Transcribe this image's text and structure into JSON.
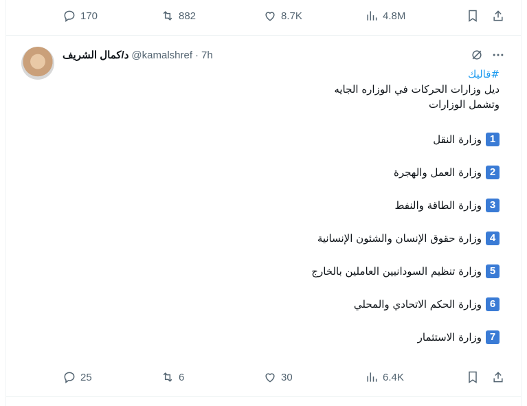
{
  "prev_tweet": {
    "actions": {
      "reply_count": "170",
      "retweet_count": "882",
      "like_count": "8.7K",
      "views_count": "4.8M"
    }
  },
  "tweet": {
    "display_name": "د/كمال الشريف",
    "handle": "@kamalshref",
    "dot": "·",
    "time": "7h",
    "hashtag": "#قاليك",
    "text_lines": [
      "ديل وزارات الحركات في الوزاره الجايه",
      "وتشمل الوزارات"
    ],
    "items": [
      {
        "num": "1",
        "label": "وزارة النقل"
      },
      {
        "num": "2",
        "label": "وزارة العمل والهجرة"
      },
      {
        "num": "3",
        "label": "وزارة الطاقة والنفط"
      },
      {
        "num": "4",
        "label": "وزارة حقوق الإنسان والشئون الإنسانية"
      },
      {
        "num": "5",
        "label": "وزارة تنظيم السودانيين العاملين بالخارج"
      },
      {
        "num": "6",
        "label": "وزارة الحكم الاتحادي والمحلي"
      },
      {
        "num": "7",
        "label": "وزارة الاستثمار"
      }
    ],
    "actions": {
      "reply_count": "25",
      "retweet_count": "6",
      "like_count": "30",
      "views_count": "6.4K"
    }
  },
  "icons": {
    "reply": "reply-icon",
    "retweet": "retweet-icon",
    "like": "heart-icon",
    "views": "views-icon",
    "bookmark": "bookmark-icon",
    "share": "share-icon",
    "grok": "grok-icon",
    "more": "more-icon"
  },
  "colors": {
    "accent": "#1d9bf0",
    "muted": "#536471",
    "number_badge": "#3a7bd5"
  }
}
